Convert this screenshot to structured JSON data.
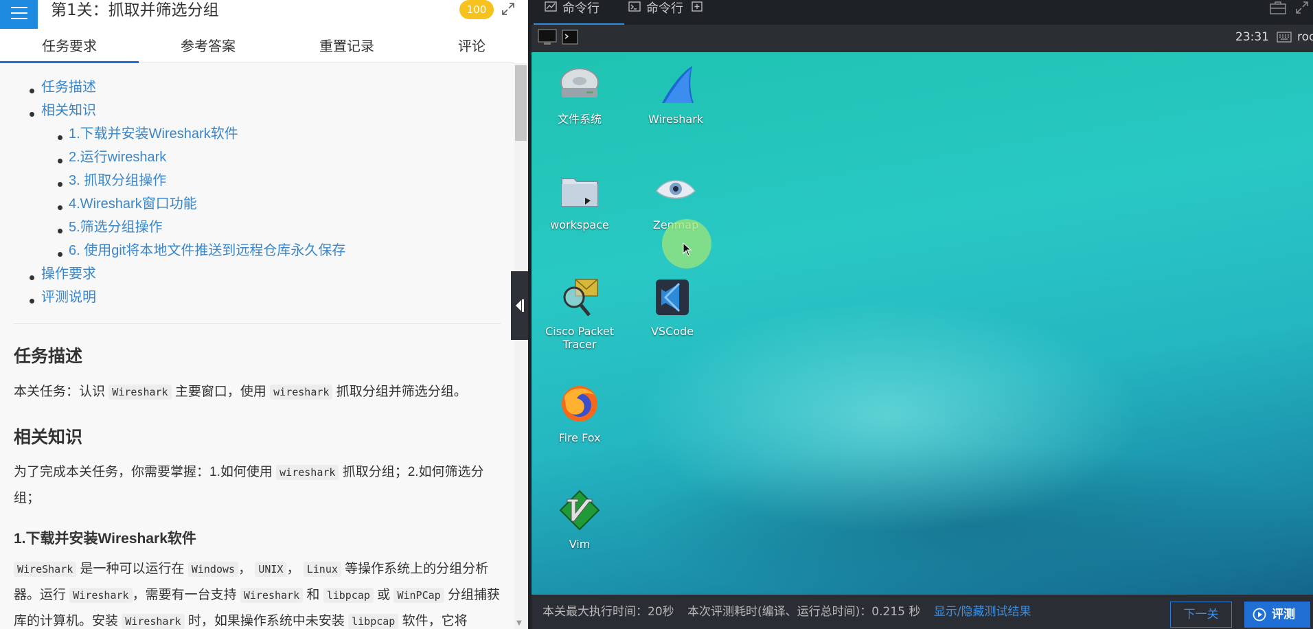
{
  "header": {
    "title": "第1关：抓取并筛选分组",
    "score": "100"
  },
  "tabs": [
    "任务要求",
    "参考答案",
    "重置记录",
    "评论"
  ],
  "toc": {
    "items": [
      "任务描述",
      "相关知识"
    ],
    "sub_items": [
      "1.下载并安装Wireshark软件",
      "2.运行wireshark",
      "3. 抓取分组操作",
      "4.Wireshark窗口功能",
      "5.筛选分组操作",
      "6. 使用git将本地文件推送到远程仓库永久保存"
    ],
    "tail_items": [
      "操作要求",
      "评测说明"
    ]
  },
  "content": {
    "h_task": "任务描述",
    "p_task_1": "本关任务：认识",
    "p_task_code1": "Wireshark",
    "p_task_2": "主要窗口，使用",
    "p_task_code2": "wireshark",
    "p_task_3": "抓取分组并筛选分组。",
    "h_knowledge": "相关知识",
    "p_know_1": "为了完成本关任务，你需要掌握：1.如何使用",
    "p_know_code": "wireshark",
    "p_know_2": "抓取分组；2.如何筛选分组；",
    "h_download": "1.下载并安装Wireshark软件",
    "p_dl": {
      "c1": "WireShark",
      "t1": " 是一种可以运行在 ",
      "c2": "Windows",
      "t2": "， ",
      "c3": "UNIX",
      "t3": "， ",
      "c4": "Linux",
      "t4": " 等操作系统上的分组分析器。运行 ",
      "c5": "Wireshark",
      "t5": "，需要有一台支持 ",
      "c6": "Wireshark",
      "t6": " 和 ",
      "c7": "libpcap",
      "t7": " 或 ",
      "c8": "WinPCap",
      "t8": " 分组捕获库的计算机。安装 ",
      "c9": "Wireshark",
      "t9": " 时，如果操作系统中未安装 ",
      "c10": "libpcap",
      "t10": " 软件，它将"
    }
  },
  "right": {
    "tab1": "命令行",
    "tab2": "命令行",
    "clock": "23:31",
    "user": "root"
  },
  "desktop": {
    "icons": [
      {
        "name": "file-system",
        "label": "文件系统"
      },
      {
        "name": "wireshark",
        "label": "Wireshark"
      },
      {
        "name": "workspace",
        "label": "workspace"
      },
      {
        "name": "zenmap",
        "label": "Zenmap"
      },
      {
        "name": "cisco-packet-tracer",
        "label": "Cisco Packet Tracer"
      },
      {
        "name": "vscode",
        "label": "VSCode"
      },
      {
        "name": "firefox",
        "label": "Fire Fox"
      },
      {
        "name": "vim",
        "label": "Vim"
      }
    ]
  },
  "status": {
    "max_time": "本关最大执行时间：20秒",
    "eval_time": "本次评测耗时(编译、运行总时间)：0.215 秒",
    "toggle_link": "显示/隐藏测试结果",
    "next_label": "下一关",
    "eval_label": "评测"
  }
}
